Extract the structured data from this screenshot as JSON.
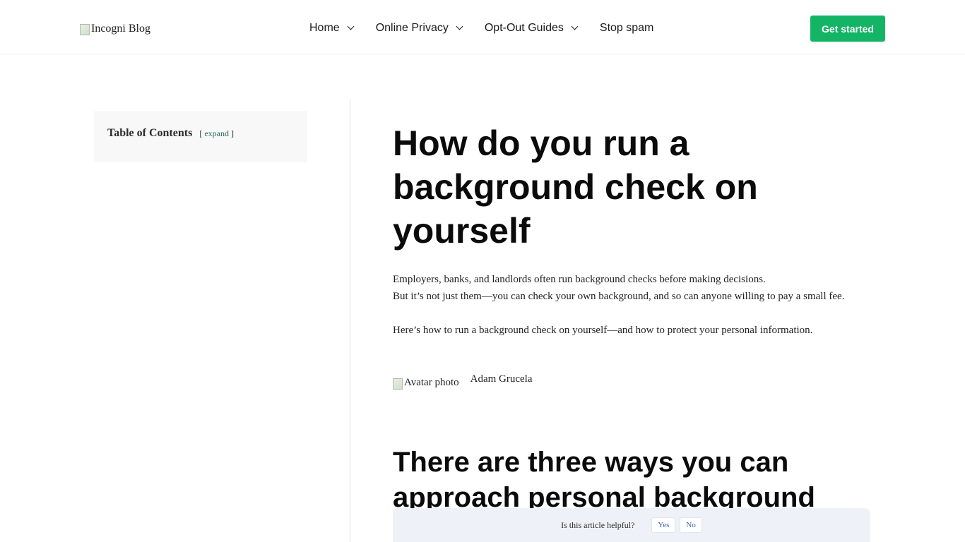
{
  "header": {
    "logo_alt": "Incogni Blog",
    "nav": [
      {
        "label": "Home",
        "has_dropdown": true
      },
      {
        "label": "Online Privacy",
        "has_dropdown": true
      },
      {
        "label": "Opt-Out Guides",
        "has_dropdown": true
      },
      {
        "label": "Stop spam",
        "has_dropdown": false
      }
    ],
    "cta_label": "Get started",
    "cta_color": "#13b466"
  },
  "toc": {
    "title": "Table of Contents",
    "expand_open": "[",
    "expand_label": "expand",
    "expand_close": "]"
  },
  "article": {
    "title": "How do you run a background check on yourself",
    "intro_line1": "Employers, banks, and landlords often run background checks before making decisions.",
    "intro_line2": "But it’s not just them—you can check your own background, and so can anyone willing to pay a small fee.",
    "intro_p2": "Here’s how to run a background check on yourself—and how to protect your personal information.",
    "avatar_alt": "Avatar photo",
    "author": "Adam Grucela",
    "section_heading": "There are three ways you can approach personal background"
  },
  "feedback": {
    "question": "Is this article helpful?",
    "yes_label": "Yes",
    "no_label": "No"
  }
}
